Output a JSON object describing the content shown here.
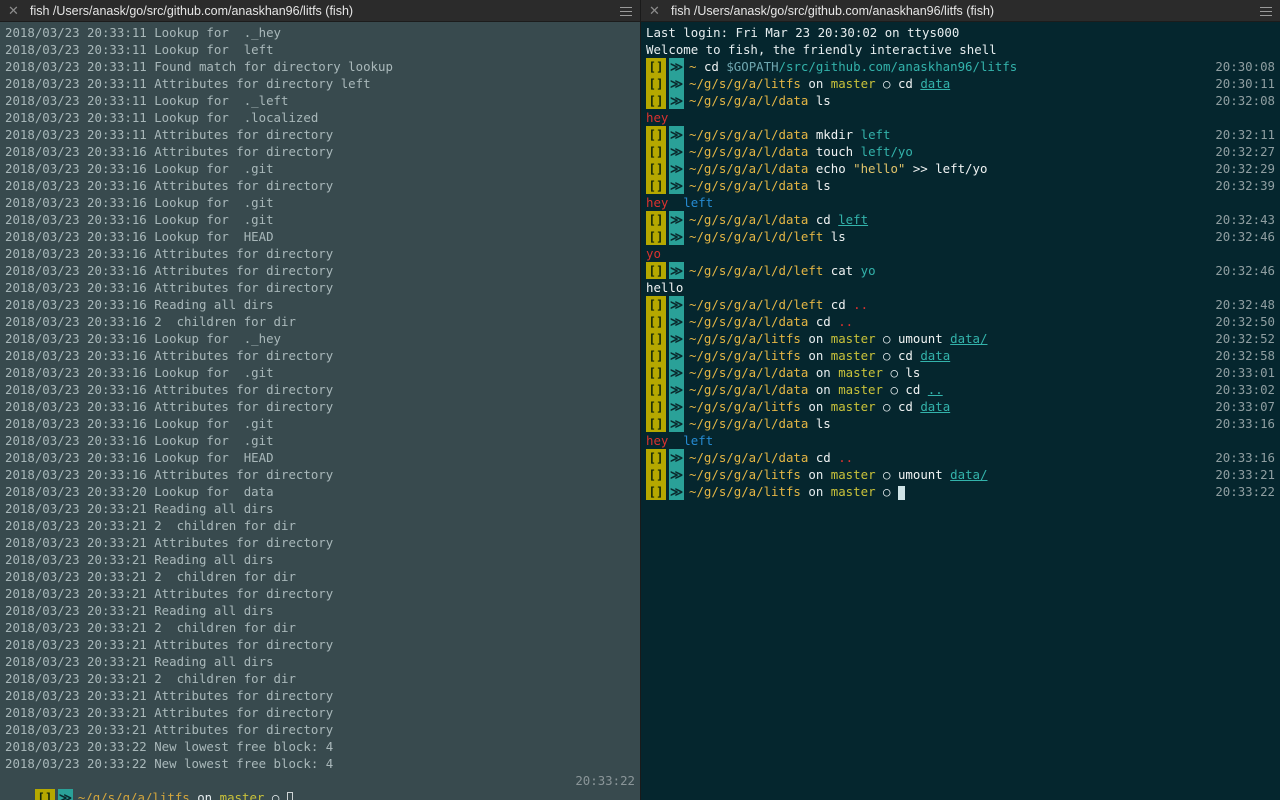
{
  "left": {
    "title": "fish  /Users/anask/go/src/github.com/anaskhan96/litfs (fish)",
    "close_glyph": "✕",
    "log": [
      "2018/03/23 20:33:11 Lookup for  ._hey",
      "2018/03/23 20:33:11 Lookup for  left",
      "2018/03/23 20:33:11 Found match for directory lookup",
      "2018/03/23 20:33:11 Attributes for directory left",
      "2018/03/23 20:33:11 Lookup for  ._left",
      "2018/03/23 20:33:11 Lookup for  .localized",
      "2018/03/23 20:33:11 Attributes for directory",
      "2018/03/23 20:33:16 Attributes for directory",
      "2018/03/23 20:33:16 Lookup for  .git",
      "2018/03/23 20:33:16 Attributes for directory",
      "2018/03/23 20:33:16 Lookup for  .git",
      "2018/03/23 20:33:16 Lookup for  .git",
      "2018/03/23 20:33:16 Lookup for  HEAD",
      "2018/03/23 20:33:16 Attributes for directory",
      "2018/03/23 20:33:16 Attributes for directory",
      "2018/03/23 20:33:16 Attributes for directory",
      "2018/03/23 20:33:16 Reading all dirs",
      "2018/03/23 20:33:16 2  children for dir",
      "2018/03/23 20:33:16 Lookup for  ._hey",
      "2018/03/23 20:33:16 Attributes for directory",
      "2018/03/23 20:33:16 Lookup for  .git",
      "2018/03/23 20:33:16 Attributes for directory",
      "2018/03/23 20:33:16 Attributes for directory",
      "2018/03/23 20:33:16 Lookup for  .git",
      "2018/03/23 20:33:16 Lookup for  .git",
      "2018/03/23 20:33:16 Lookup for  HEAD",
      "2018/03/23 20:33:16 Attributes for directory",
      "2018/03/23 20:33:20 Lookup for  data",
      "2018/03/23 20:33:21 Reading all dirs",
      "2018/03/23 20:33:21 2  children for dir",
      "2018/03/23 20:33:21 Attributes for directory",
      "2018/03/23 20:33:21 Reading all dirs",
      "2018/03/23 20:33:21 2  children for dir",
      "2018/03/23 20:33:21 Attributes for directory",
      "2018/03/23 20:33:21 Reading all dirs",
      "2018/03/23 20:33:21 2  children for dir",
      "2018/03/23 20:33:21 Attributes for directory",
      "2018/03/23 20:33:21 Reading all dirs",
      "2018/03/23 20:33:21 2  children for dir",
      "2018/03/23 20:33:21 Attributes for directory",
      "2018/03/23 20:33:21 Attributes for directory",
      "2018/03/23 20:33:21 Attributes for directory",
      "2018/03/23 20:33:22 New lowest free block: 4",
      "2018/03/23 20:33:22 New lowest free block: 4"
    ],
    "prompt": {
      "badge1": "[]",
      "badge2": "≫",
      "path": "~/g/s/g/a/litfs",
      "on": "on",
      "branch": "master",
      "circle": "○",
      "time": "20:33:22"
    }
  },
  "right": {
    "title": "fish  /Users/anask/go/src/github.com/anaskhan96/litfs (fish)",
    "close_glyph": "✕",
    "badge1": "[]",
    "badge2": "≫",
    "on": "on",
    "circle": "○",
    "lines": [
      {
        "type": "text",
        "text": "Last login: Fri Mar 23 20:30:02 on ttys000"
      },
      {
        "type": "text",
        "text": "Welcome to fish, the friendly interactive shell"
      },
      {
        "type": "prompt",
        "path": "~",
        "cmd": "cd",
        "args": [
          {
            "t": "$GOPATH",
            "c": "gvar"
          },
          {
            "t": "/src/github.com/anaskhan96/litfs",
            "c": "arg",
            "sp": false
          }
        ],
        "time": "20:30:08"
      },
      {
        "type": "prompt",
        "path": "~/g/s/g/a/litfs",
        "branch": "master",
        "cmd": "cd",
        "args": [
          {
            "t": "data",
            "c": "arg ul"
          }
        ],
        "time": "20:30:11"
      },
      {
        "type": "prompt",
        "path": "~/g/s/g/a/l/data",
        "cmd": "ls",
        "args": [],
        "time": "20:32:08"
      },
      {
        "type": "out",
        "parts": [
          {
            "t": "hey",
            "c": "red"
          }
        ]
      },
      {
        "type": "prompt",
        "path": "~/g/s/g/a/l/data",
        "cmd": "mkdir",
        "args": [
          {
            "t": "left",
            "c": "arg"
          }
        ],
        "time": "20:32:11"
      },
      {
        "type": "prompt",
        "path": "~/g/s/g/a/l/data",
        "cmd": "touch",
        "args": [
          {
            "t": "left/yo",
            "c": "arg"
          }
        ],
        "time": "20:32:27"
      },
      {
        "type": "prompt",
        "path": "~/g/s/g/a/l/data",
        "cmd": "echo",
        "args": [
          {
            "t": "\"hello\"",
            "c": "str"
          },
          {
            "t": ">>",
            "c": "cmd"
          },
          {
            "t": "left/yo",
            "c": "cmd"
          }
        ],
        "time": "20:32:29"
      },
      {
        "type": "prompt",
        "path": "~/g/s/g/a/l/data",
        "cmd": "ls",
        "args": [],
        "time": "20:32:39"
      },
      {
        "type": "out",
        "parts": [
          {
            "t": "hey",
            "c": "red"
          },
          {
            "t": "  left",
            "c": "blue"
          }
        ]
      },
      {
        "type": "prompt",
        "path": "~/g/s/g/a/l/data",
        "cmd": "cd",
        "args": [
          {
            "t": "left",
            "c": "arg ul"
          }
        ],
        "time": "20:32:43"
      },
      {
        "type": "prompt",
        "path": "~/g/s/g/a/l/d/left",
        "cmd": "ls",
        "args": [],
        "time": "20:32:46"
      },
      {
        "type": "out",
        "parts": [
          {
            "t": "yo",
            "c": "red"
          }
        ]
      },
      {
        "type": "prompt",
        "path": "~/g/s/g/a/l/d/left",
        "cmd": "cat",
        "args": [
          {
            "t": "yo",
            "c": "arg"
          }
        ],
        "time": "20:32:46"
      },
      {
        "type": "out",
        "parts": [
          {
            "t": "hello",
            "c": "cmd"
          }
        ]
      },
      {
        "type": "prompt",
        "path": "~/g/s/g/a/l/d/left",
        "cmd": "cd",
        "args": [
          {
            "t": "..",
            "c": "red"
          }
        ],
        "time": "20:32:48"
      },
      {
        "type": "prompt",
        "path": "~/g/s/g/a/l/data",
        "cmd": "cd",
        "args": [
          {
            "t": "..",
            "c": "red"
          }
        ],
        "time": "20:32:50"
      },
      {
        "type": "prompt",
        "path": "~/g/s/g/a/litfs",
        "branch": "master",
        "cmd": "umount",
        "args": [
          {
            "t": "data/",
            "c": "arg ul"
          }
        ],
        "time": "20:32:52"
      },
      {
        "type": "prompt",
        "path": "~/g/s/g/a/litfs",
        "branch": "master",
        "cmd": "cd",
        "args": [
          {
            "t": "data",
            "c": "arg ul"
          }
        ],
        "time": "20:32:58"
      },
      {
        "type": "prompt",
        "path": "~/g/s/g/a/l/data",
        "branch": "master",
        "cmd": "ls",
        "args": [],
        "time": "20:33:01"
      },
      {
        "type": "prompt",
        "path": "~/g/s/g/a/l/data",
        "branch": "master",
        "cmd": "cd",
        "args": [
          {
            "t": "..",
            "c": "arg ul"
          }
        ],
        "time": "20:33:02"
      },
      {
        "type": "prompt",
        "path": "~/g/s/g/a/litfs",
        "branch": "master",
        "cmd": "cd",
        "args": [
          {
            "t": "data",
            "c": "arg ul"
          }
        ],
        "time": "20:33:07"
      },
      {
        "type": "prompt",
        "path": "~/g/s/g/a/l/data",
        "cmd": "ls",
        "args": [],
        "time": "20:33:16"
      },
      {
        "type": "out",
        "parts": [
          {
            "t": "hey",
            "c": "red"
          },
          {
            "t": "  left",
            "c": "blue"
          }
        ]
      },
      {
        "type": "prompt",
        "path": "~/g/s/g/a/l/data",
        "cmd": "cd",
        "args": [
          {
            "t": "..",
            "c": "red"
          }
        ],
        "time": "20:33:16"
      },
      {
        "type": "prompt",
        "path": "~/g/s/g/a/litfs",
        "branch": "master",
        "cmd": "umount",
        "args": [
          {
            "t": "data/",
            "c": "arg ul"
          }
        ],
        "time": "20:33:21"
      },
      {
        "type": "prompt",
        "path": "~/g/s/g/a/litfs",
        "branch": "master",
        "cmd": "",
        "args": [],
        "cursor": true,
        "time": "20:33:22"
      }
    ]
  }
}
